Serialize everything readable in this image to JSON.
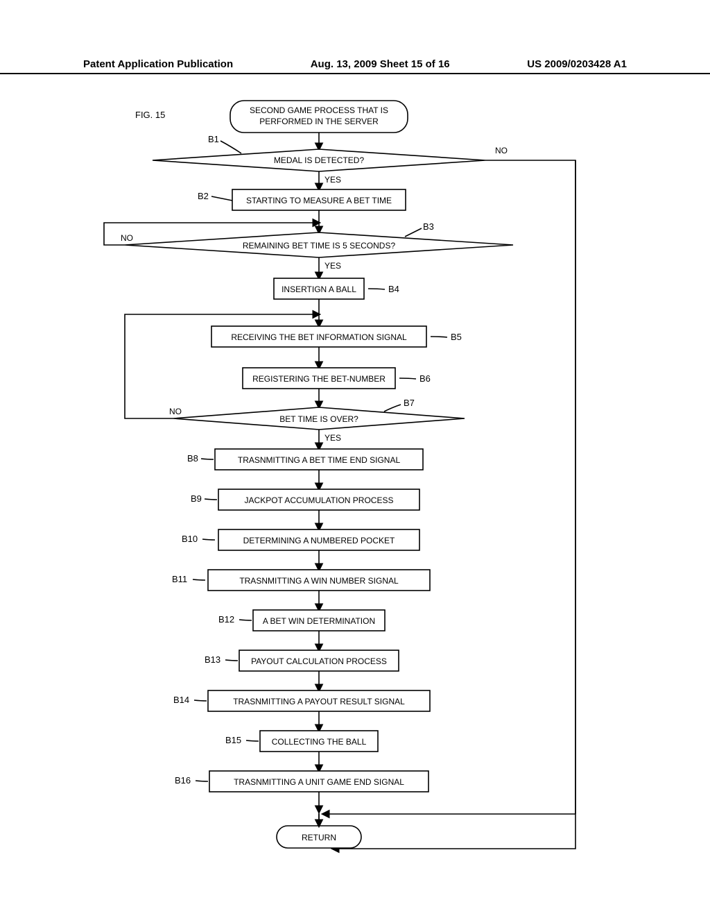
{
  "header": {
    "left": "Patent Application Publication",
    "center": "Aug. 13, 2009  Sheet 15 of 16",
    "right": "US 2009/0203428 A1"
  },
  "figure_label": "FIG.  15",
  "start": "SECOND GAME PROCESS THAT IS\nPERFORMED IN THE SERVER",
  "end": "RETURN",
  "labels": {
    "B1": "B1",
    "B2": "B2",
    "B3": "B3",
    "B4": "B4",
    "B5": "B5",
    "B6": "B6",
    "B7": "B7",
    "B8": "B8",
    "B9": "B9",
    "B10": "B10",
    "B11": "B11",
    "B12": "B12",
    "B13": "B13",
    "B14": "B14",
    "B15": "B15",
    "B16": "B16"
  },
  "steps": {
    "B1": "MEDAL IS DETECTED?",
    "B2": "STARTING TO MEASURE A BET TIME",
    "B3": "REMAINING BET TIME IS 5 SECONDS?",
    "B4": "INSERTIGN A BALL",
    "B5": "RECEIVING THE BET INFORMATION SIGNAL",
    "B6": "REGISTERING THE BET-NUMBER",
    "B7": "BET TIME IS OVER?",
    "B8": "TRASNMITTING A BET TIME END SIGNAL",
    "B9": "JACKPOT ACCUMULATION PROCESS",
    "B10": "DETERMINING A NUMBERED POCKET",
    "B11": "TRASNMITTING A WIN NUMBER SIGNAL",
    "B12": "A BET WIN DETERMINATION",
    "B13": "PAYOUT CALCULATION PROCESS",
    "B14": "TRASNMITTING A PAYOUT RESULT SIGNAL",
    "B15": "COLLECTING THE BALL",
    "B16": "TRASNMITTING A UNIT GAME END SIGNAL"
  },
  "branches": {
    "yes": "YES",
    "no": "NO"
  }
}
